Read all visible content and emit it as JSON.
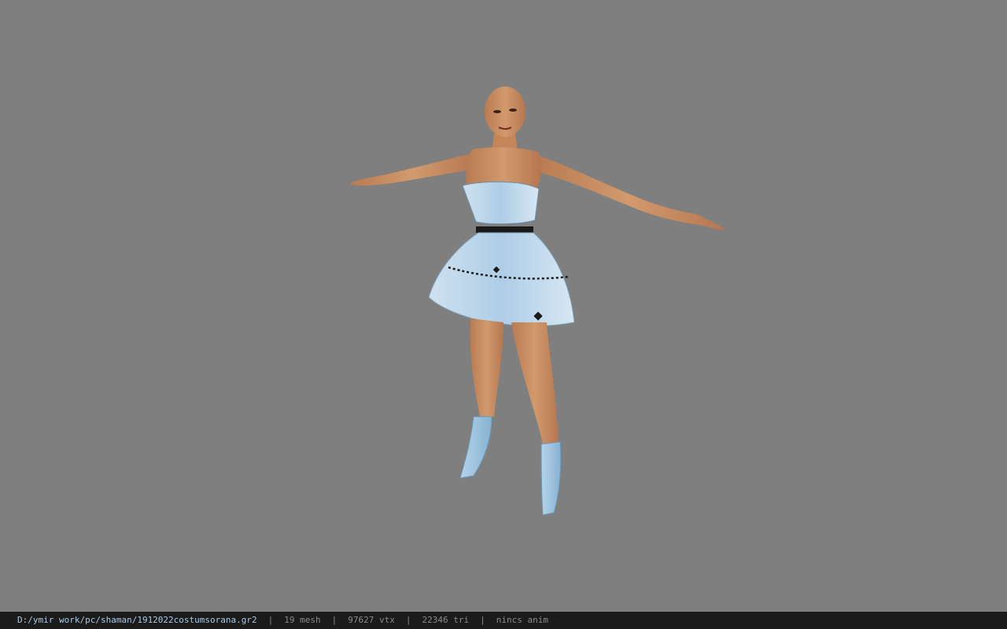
{
  "viewport": {
    "background": "#7f7f7f",
    "model": "character-model"
  },
  "status": {
    "path": "D:/ymir work/pc/shaman/1912022costumsorana.gr2",
    "separator": "|",
    "mesh": "19 mesh",
    "vtx": "97627 vtx",
    "tri": "22346 tri",
    "anim": "nincs anim"
  },
  "colors": {
    "skin": "#c98a5e",
    "dress": "#bcd6ea",
    "boots": "#9cc3de",
    "statusbar_bg": "#1b1b1b",
    "path_text": "#a9c9e6"
  }
}
